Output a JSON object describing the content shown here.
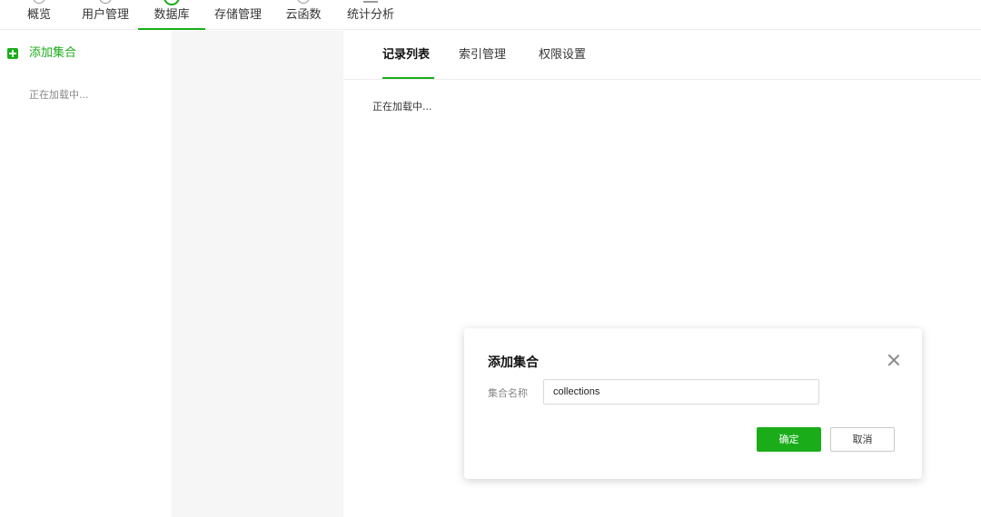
{
  "nav": {
    "items": [
      {
        "label": "概览",
        "icon": "circle-icon"
      },
      {
        "label": "用户管理",
        "icon": "user-icon"
      },
      {
        "label": "数据库",
        "icon": "database-icon"
      },
      {
        "label": "存储管理",
        "icon": "storage-icon"
      },
      {
        "label": "云函数",
        "icon": "function-icon"
      },
      {
        "label": "统计分析",
        "icon": "chart-icon"
      }
    ],
    "active": "数据库"
  },
  "sidebar": {
    "add_label": "添加集合",
    "loading": "正在加载中..."
  },
  "tabs": [
    {
      "label": "记录列表"
    },
    {
      "label": "索引管理"
    },
    {
      "label": "权限设置"
    }
  ],
  "active_tab": "记录列表",
  "main": {
    "loading": "正在加载中..."
  },
  "dialog": {
    "title": "添加集合",
    "field_label": "集合名称",
    "field_value": "collections",
    "ok_label": "确定",
    "cancel_label": "取消"
  },
  "colors": {
    "accent": "#1aad19",
    "panel_bg": "#f6f6f6"
  }
}
